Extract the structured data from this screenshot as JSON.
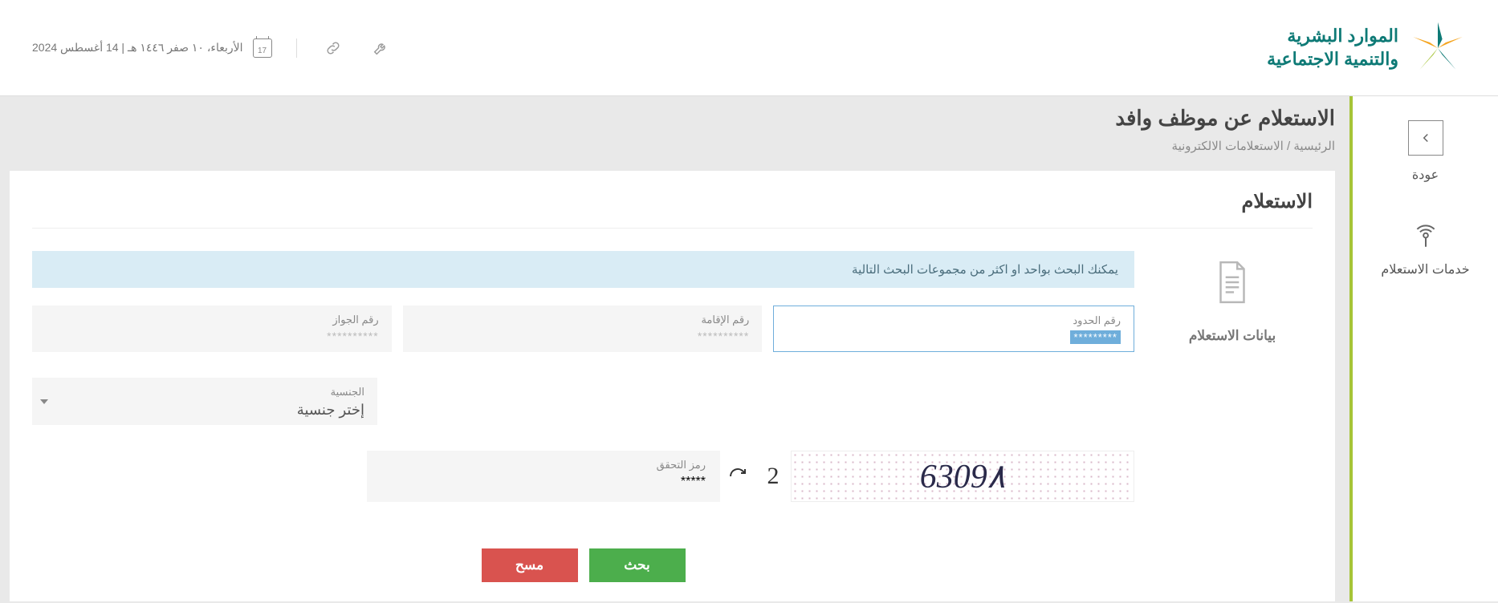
{
  "header": {
    "logo_line1": "الموارد البشرية",
    "logo_line2": "والتنمية الاجتماعية",
    "date_text": "الأربعاء، ١٠ صفر ١٤٤٦ هـ | 14 أغسطس 2024",
    "calendar_day": "17"
  },
  "nav": {
    "back": "عودة",
    "services": "خدمات الاستعلام"
  },
  "page": {
    "title": "الاستعلام عن موظف وافد",
    "crumb1": "الرئيسية",
    "crumb_sep": " / ",
    "crumb2": "الاستعلامات الالكترونية"
  },
  "panel": {
    "title": "الاستعلام",
    "side_label": "بيانات الاستعلام",
    "info_banner": "يمكنك البحث بواحد او اكثر من مجموعات البحث التالية"
  },
  "fields": {
    "border": {
      "label": "رقم الحدود",
      "value": "*********"
    },
    "iqama": {
      "label": "رقم الإقامة",
      "placeholder": "**********"
    },
    "passport": {
      "label": "رقم الجواز",
      "placeholder": "**********"
    },
    "nationality": {
      "label": "الجنسية",
      "selected": "إختر جنسية"
    },
    "captcha_label": "رمز التحقق",
    "captcha_placeholder": "*****"
  },
  "captcha": {
    "glyphs": "6309٨",
    "extra": "2"
  },
  "buttons": {
    "search": "بحث",
    "clear": "مسح"
  }
}
